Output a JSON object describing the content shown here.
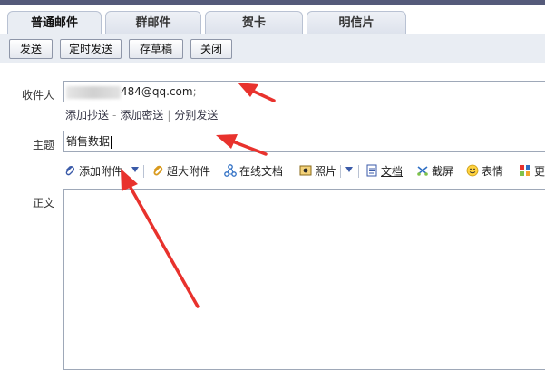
{
  "tabs": [
    {
      "label": "普通邮件",
      "active": true
    },
    {
      "label": "群邮件"
    },
    {
      "label": "贺卡"
    },
    {
      "label": "明信片"
    }
  ],
  "toolbar": {
    "send": "发送",
    "scheduled_send": "定时发送",
    "save_draft": "存草稿",
    "close": "关闭"
  },
  "recipient": {
    "label": "收件人",
    "value_visible": "484@qq.com",
    "separator": ";"
  },
  "recipient_links": {
    "add_cc": "添加抄送",
    "dash": "-",
    "add_bcc": "添加密送",
    "pipe": "|",
    "separate_send": "分别发送"
  },
  "subject": {
    "label": "主题",
    "value": "销售数据"
  },
  "attach_tools": {
    "add_attachment": "添加附件",
    "large_attachment": "超大附件",
    "online_docs": "在线文档",
    "photos": "照片",
    "document": "文档",
    "screenshot": "截屏",
    "emoji": "表情",
    "more": "更"
  },
  "body": {
    "label": "正文"
  },
  "colors": {
    "accent_header": "#555a7a",
    "arrow": "#e8322d",
    "link_blue": "#3a5aa8"
  }
}
